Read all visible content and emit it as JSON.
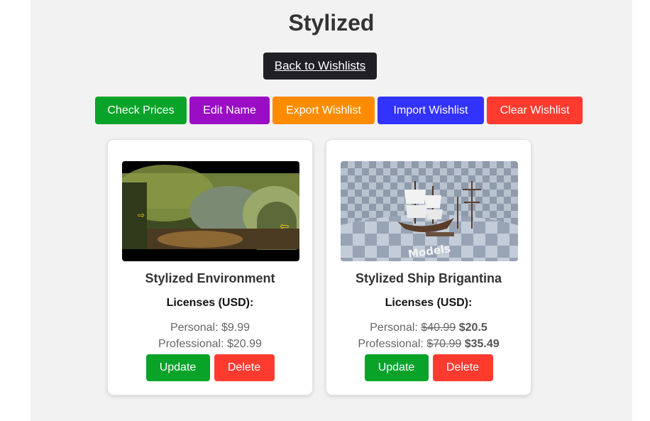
{
  "page": {
    "title": "Stylized",
    "back_label": "Back to Wishlists"
  },
  "toolbar": [
    {
      "label": "Check Prices",
      "color": "#0aa32a"
    },
    {
      "label": "Edit Name",
      "color": "#9b0dc4"
    },
    {
      "label": "Export Wishlist",
      "color": "#ff8c00"
    },
    {
      "label": "Import Wishlist",
      "color": "#3333ff"
    },
    {
      "label": "Clear Wishlist",
      "color": "#ff3b30"
    }
  ],
  "products": [
    {
      "name": "Stylized Environment",
      "licenses_label": "Licenses (USD):",
      "personal_label": "Personal:",
      "personal_price": "$9.99",
      "professional_label": "Professional:",
      "professional_price": "$20.99",
      "update_label": "Update",
      "delete_label": "Delete"
    },
    {
      "name": "Stylized Ship Brigantina",
      "licenses_label": "Licenses (USD):",
      "personal_label": "Personal:",
      "personal_old": "$40.99",
      "personal_new": "$20.5",
      "professional_label": "Professional:",
      "professional_old": "$70.99",
      "professional_new": "$35.49",
      "thumb_caption": "Models",
      "update_label": "Update",
      "delete_label": "Delete"
    }
  ],
  "colors": {
    "update": "#0aa32a",
    "delete": "#ff3b30"
  }
}
